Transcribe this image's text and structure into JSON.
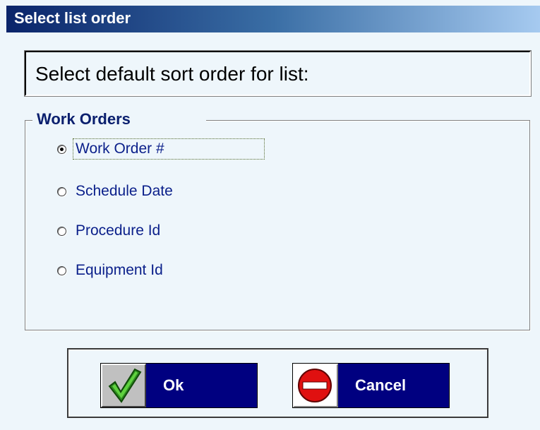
{
  "window": {
    "title": "Select list order"
  },
  "prompt": {
    "text": "Select default sort order for list:"
  },
  "group": {
    "label": "Work Orders",
    "options": [
      {
        "label": "Work Order #",
        "checked": true
      },
      {
        "label": "Schedule Date",
        "checked": false
      },
      {
        "label": "Procedure Id",
        "checked": false
      },
      {
        "label": "Equipment Id",
        "checked": false
      }
    ]
  },
  "buttons": {
    "ok_label": "Ok",
    "ok_icon": "checkmark-icon",
    "cancel_label": "Cancel",
    "cancel_icon": "no-entry-icon"
  },
  "colors": {
    "title_gradient_start": "#0a246a",
    "title_gradient_end": "#a6caf0",
    "button_bg": "#000080",
    "option_text": "#0a1f8a",
    "check_green": "#2e8b20",
    "cancel_red": "#e01010"
  }
}
